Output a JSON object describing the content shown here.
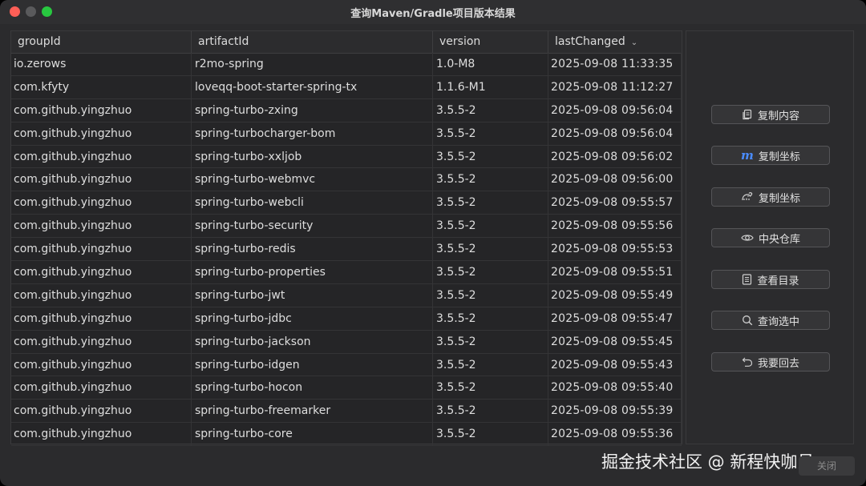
{
  "window": {
    "title": "查询Maven/Gradle项目版本结果"
  },
  "table": {
    "headers": [
      "groupId",
      "artifactId",
      "version",
      "lastChanged"
    ],
    "sorted_column_icon": "chevron-down-icon",
    "rows": [
      [
        "io.zerows",
        "r2mo-spring",
        "1.0-M8",
        "2025-09-08 11:33:35"
      ],
      [
        "com.kfyty",
        "loveqq-boot-starter-spring-tx",
        "1.1.6-M1",
        "2025-09-08 11:12:27"
      ],
      [
        "com.github.yingzhuo",
        "spring-turbo-zxing",
        "3.5.5-2",
        "2025-09-08 09:56:04"
      ],
      [
        "com.github.yingzhuo",
        "spring-turbocharger-bom",
        "3.5.5-2",
        "2025-09-08 09:56:04"
      ],
      [
        "com.github.yingzhuo",
        "spring-turbo-xxljob",
        "3.5.5-2",
        "2025-09-08 09:56:02"
      ],
      [
        "com.github.yingzhuo",
        "spring-turbo-webmvc",
        "3.5.5-2",
        "2025-09-08 09:56:00"
      ],
      [
        "com.github.yingzhuo",
        "spring-turbo-webcli",
        "3.5.5-2",
        "2025-09-08 09:55:57"
      ],
      [
        "com.github.yingzhuo",
        "spring-turbo-security",
        "3.5.5-2",
        "2025-09-08 09:55:56"
      ],
      [
        "com.github.yingzhuo",
        "spring-turbo-redis",
        "3.5.5-2",
        "2025-09-08 09:55:53"
      ],
      [
        "com.github.yingzhuo",
        "spring-turbo-properties",
        "3.5.5-2",
        "2025-09-08 09:55:51"
      ],
      [
        "com.github.yingzhuo",
        "spring-turbo-jwt",
        "3.5.5-2",
        "2025-09-08 09:55:49"
      ],
      [
        "com.github.yingzhuo",
        "spring-turbo-jdbc",
        "3.5.5-2",
        "2025-09-08 09:55:47"
      ],
      [
        "com.github.yingzhuo",
        "spring-turbo-jackson",
        "3.5.5-2",
        "2025-09-08 09:55:45"
      ],
      [
        "com.github.yingzhuo",
        "spring-turbo-idgen",
        "3.5.5-2",
        "2025-09-08 09:55:43"
      ],
      [
        "com.github.yingzhuo",
        "spring-turbo-hocon",
        "3.5.5-2",
        "2025-09-08 09:55:40"
      ],
      [
        "com.github.yingzhuo",
        "spring-turbo-freemarker",
        "3.5.5-2",
        "2025-09-08 09:55:39"
      ],
      [
        "com.github.yingzhuo",
        "spring-turbo-core",
        "3.5.5-2",
        "2025-09-08 09:55:36"
      ]
    ]
  },
  "actions": [
    {
      "label": "复制内容",
      "icon": "copy-icon"
    },
    {
      "label": "复制坐标",
      "icon": "maven-icon"
    },
    {
      "label": "复制坐标",
      "icon": "gradle-icon"
    },
    {
      "label": "中央仓库",
      "icon": "eye-icon"
    },
    {
      "label": "查看目录",
      "icon": "document-icon"
    },
    {
      "label": "查询选中",
      "icon": "search-icon"
    },
    {
      "label": "我要回去",
      "icon": "back-arrow-icon"
    }
  ],
  "actions_maven_glyph": "m",
  "watermark": "掘金技术社区 @ 新程快咖员",
  "footer_button_label": "关闭",
  "colors": {
    "window_bg": "#2b2b2d",
    "table_bg": "#252527",
    "close": "#ff5f57",
    "maximize": "#28c840",
    "maven_accent": "#4a8cff"
  }
}
